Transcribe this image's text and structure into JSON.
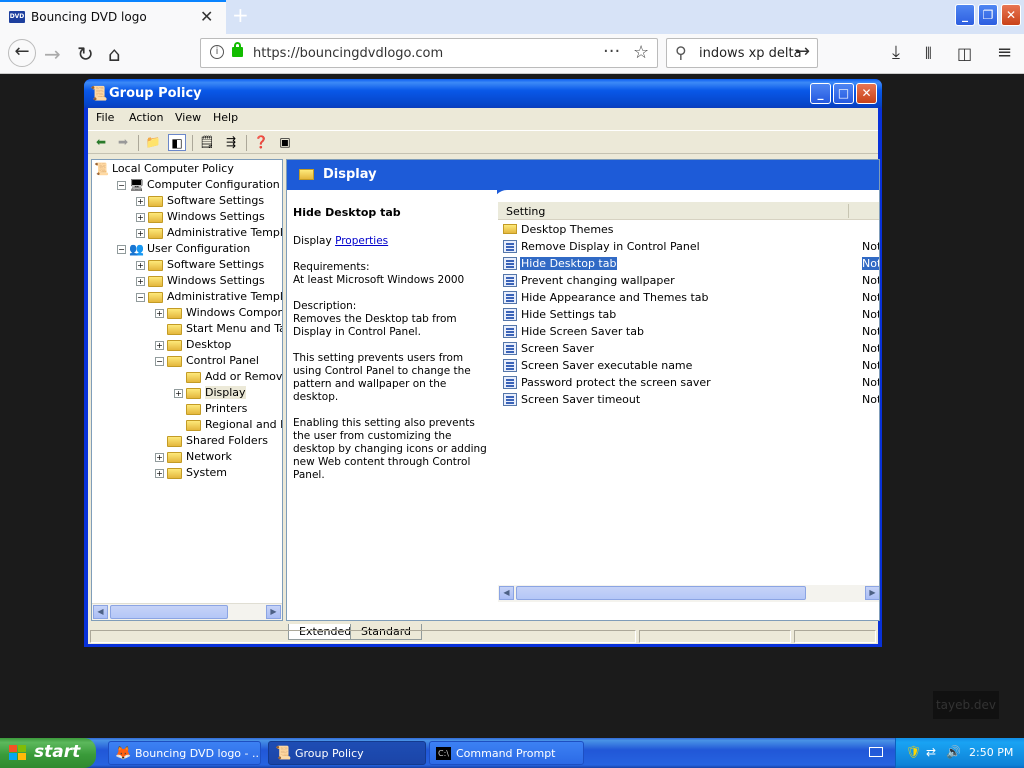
{
  "browser": {
    "tab_title": "Bouncing DVD logo",
    "favicon_text": "DVD",
    "url": "https://bouncingdvdlogo.com",
    "search_query": "indows xp delta"
  },
  "window": {
    "title": "Group Policy",
    "menu": [
      "File",
      "Action",
      "View",
      "Help"
    ]
  },
  "tree": [
    {
      "label": "Local Computer Policy",
      "depth": 0,
      "toggle": "",
      "icon": "policy"
    },
    {
      "label": "Computer Configuration",
      "depth": 1,
      "toggle": "−",
      "icon": "computer"
    },
    {
      "label": "Software Settings",
      "depth": 2,
      "toggle": "+",
      "icon": "folder"
    },
    {
      "label": "Windows Settings",
      "depth": 2,
      "toggle": "+",
      "icon": "folder"
    },
    {
      "label": "Administrative Templates",
      "depth": 2,
      "toggle": "+",
      "icon": "folder"
    },
    {
      "label": "User Configuration",
      "depth": 1,
      "toggle": "−",
      "icon": "user"
    },
    {
      "label": "Software Settings",
      "depth": 2,
      "toggle": "+",
      "icon": "folder"
    },
    {
      "label": "Windows Settings",
      "depth": 2,
      "toggle": "+",
      "icon": "folder"
    },
    {
      "label": "Administrative Templates",
      "depth": 2,
      "toggle": "−",
      "icon": "folder"
    },
    {
      "label": "Windows Components",
      "depth": 3,
      "toggle": "+",
      "icon": "folder"
    },
    {
      "label": "Start Menu and Taskbar",
      "depth": 3,
      "toggle": "",
      "icon": "folder"
    },
    {
      "label": "Desktop",
      "depth": 3,
      "toggle": "+",
      "icon": "folder"
    },
    {
      "label": "Control Panel",
      "depth": 3,
      "toggle": "−",
      "icon": "folder"
    },
    {
      "label": "Add or Remove Programs",
      "depth": 4,
      "toggle": "",
      "icon": "folder"
    },
    {
      "label": "Display",
      "depth": 4,
      "toggle": "+",
      "icon": "folder",
      "selected": true
    },
    {
      "label": "Printers",
      "depth": 4,
      "toggle": "",
      "icon": "folder"
    },
    {
      "label": "Regional and Language Options",
      "depth": 4,
      "toggle": "",
      "icon": "folder"
    },
    {
      "label": "Shared Folders",
      "depth": 3,
      "toggle": "",
      "icon": "folder"
    },
    {
      "label": "Network",
      "depth": 3,
      "toggle": "+",
      "icon": "folder"
    },
    {
      "label": "System",
      "depth": 3,
      "toggle": "+",
      "icon": "folder"
    }
  ],
  "right": {
    "header": "Display",
    "desc_title": "Hide Desktop tab",
    "desc_display": "Display",
    "desc_link": "Properties",
    "requirements_label": "Requirements:",
    "requirements": "At least Microsoft Windows 2000",
    "description_label": "Description:",
    "description": "Removes the Desktop tab from Display in Control Panel.",
    "para2": "This setting prevents users from using Control Panel to change the pattern and wallpaper on the desktop.",
    "para3": "Enabling this setting also prevents the user from customizing the desktop by changing icons or adding new Web content through Control Panel.",
    "column_setting": "Setting",
    "settings": [
      {
        "name": "Desktop Themes",
        "state": "",
        "icon": "folder"
      },
      {
        "name": "Remove Display in Control Panel",
        "state": "Not",
        "icon": "policy"
      },
      {
        "name": "Hide Desktop tab",
        "state": "Not",
        "icon": "policy",
        "selected": true
      },
      {
        "name": "Prevent changing wallpaper",
        "state": "Not",
        "icon": "policy"
      },
      {
        "name": "Hide Appearance and Themes tab",
        "state": "Not",
        "icon": "policy"
      },
      {
        "name": "Hide Settings tab",
        "state": "Not",
        "icon": "policy"
      },
      {
        "name": "Hide Screen Saver tab",
        "state": "Not",
        "icon": "policy"
      },
      {
        "name": "Screen Saver",
        "state": "Not",
        "icon": "policy"
      },
      {
        "name": "Screen Saver executable name",
        "state": "Not",
        "icon": "policy"
      },
      {
        "name": "Password protect the screen saver",
        "state": "Not",
        "icon": "policy"
      },
      {
        "name": "Screen Saver timeout",
        "state": "Not",
        "icon": "policy"
      }
    ],
    "tabs": [
      "Extended",
      "Standard"
    ]
  },
  "watermark": "tayeb.dev",
  "taskbar": {
    "start_label": "start",
    "buttons": [
      {
        "label": "Bouncing DVD logo - ...",
        "active": false
      },
      {
        "label": "Group Policy",
        "active": true
      },
      {
        "label": "Command Prompt",
        "active": false
      }
    ],
    "clock": "2:50 PM"
  }
}
